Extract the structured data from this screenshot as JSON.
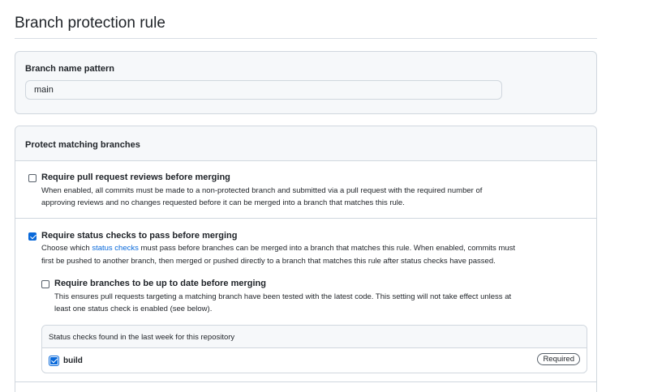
{
  "page": {
    "title": "Branch protection rule"
  },
  "pattern": {
    "label": "Branch name pattern",
    "value": "main"
  },
  "protect": {
    "header": "Protect matching branches",
    "pr_reviews": {
      "checked": false,
      "title": "Require pull request reviews before merging",
      "desc_line1": "When enabled, all commits must be made to a non-protected branch and submitted via a pull request with the required number of",
      "desc_line2": "approving reviews and no changes requested before it can be merged into a branch that matches this rule."
    },
    "status_checks": {
      "checked": true,
      "title": "Require status checks to pass before merging",
      "desc_pre": "Choose which ",
      "desc_link": "status checks",
      "desc_post": " must pass before branches can be merged into a branch that matches this rule. When enabled, commits must",
      "desc_line2": "first be pushed to another branch, then merged or pushed directly to a branch that matches this rule after status checks have passed."
    },
    "up_to_date": {
      "checked": false,
      "title": "Require branches to be up to date before merging",
      "desc_line1": "This ensures pull requests targeting a matching branch have been tested with the latest code. This setting will not take effect unless at",
      "desc_line2": "least one status check is enabled (see below)."
    },
    "checks_found": {
      "header": "Status checks found in the last week for this repository",
      "items": [
        {
          "name": "build",
          "checked": true,
          "badge": "Required"
        }
      ]
    }
  },
  "colors": {
    "accent": "#0969da",
    "border": "#d0d7de",
    "panel_bg": "#f6f8fa"
  }
}
